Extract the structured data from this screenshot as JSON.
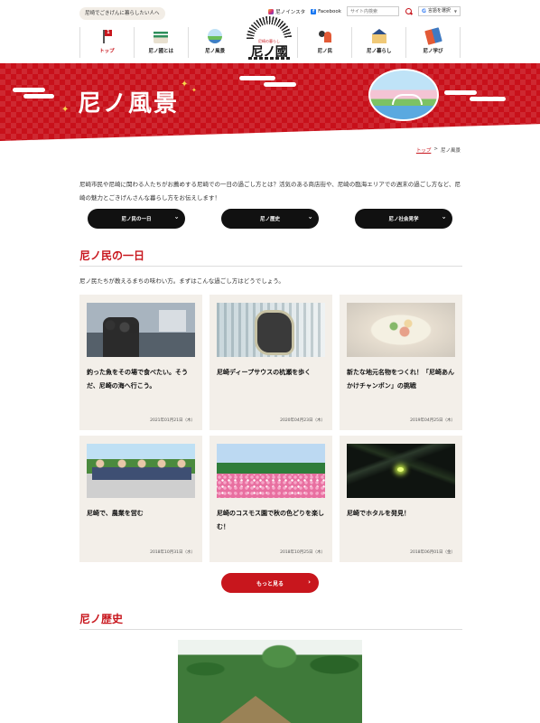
{
  "header": {
    "tagline": "尼崎でごきげんに暮らしたい人へ",
    "instagram_label": "尼ノインスタ",
    "facebook_label": "Facebook",
    "search_placeholder": "サイト内検索",
    "lang_label": "言語を選択",
    "lang_arrow": "▼",
    "logo_sub": "尼崎の暮らし",
    "logo_text": "尼ノ國"
  },
  "nav": [
    {
      "label": "トップ",
      "icon": "flag-icon",
      "active": true
    },
    {
      "label": "尼ノ國とは",
      "icon": "castle-icon"
    },
    {
      "label": "尼ノ風景",
      "icon": "scenery-icon"
    },
    {
      "label": "尼ノ民",
      "icon": "people-icon"
    },
    {
      "label": "尼ノ暮らし",
      "icon": "house-icon"
    },
    {
      "label": "尼ノ学び",
      "icon": "book-icon"
    }
  ],
  "hero": {
    "title": "尼ノ風景"
  },
  "breadcrumb": {
    "home": "トップ",
    "separator": ">",
    "current": "尼ノ風景"
  },
  "intro": "尼崎市民や尼崎に関わる人たちがお薦めする尼崎での一日の過ごし方とは？活気のある商店街や、尼崎の臨海エリアでの週末の過ごし方など、尼崎の魅力とごきげんさんな暮らし方をお伝えします！",
  "pills": [
    "尼ノ民の一日",
    "尼ノ歴史",
    "尼ノ社会見学"
  ],
  "pill_chevron": "›",
  "section1": {
    "title": "尼ノ民の一日",
    "desc": "尼ノ民たちが教えるまちの味わい方。まずはこんな過ごし方はどうでしょう。"
  },
  "cards": [
    {
      "title": "釣った魚をその場で食べたい。そうだ、尼崎の海へ行こう。",
      "date": "2021年01月21日（木）"
    },
    {
      "title": "尼崎ディープサウスの杭瀬を歩く",
      "date": "2020年04月23日（木）"
    },
    {
      "title": "新たな地元名物をつくれ！「尼崎あんかけチャンポン」の挑戦",
      "date": "2019年04月25日（木）"
    },
    {
      "title": "尼崎で、農業を営む",
      "date": "2018年10月31日（水）"
    },
    {
      "title": "尼崎のコスモス園で秋の色どりを楽しむ！",
      "date": "2018年10月25日（木）"
    },
    {
      "title": "尼崎でホタルを発見！",
      "date": "2018年06月01日（金）"
    }
  ],
  "more_button": "もっと見る",
  "section2": {
    "title": "尼ノ歴史"
  },
  "colors": {
    "brand_red": "#c8161d",
    "card_bg": "#f3efe9",
    "pill_bg": "#111111"
  }
}
